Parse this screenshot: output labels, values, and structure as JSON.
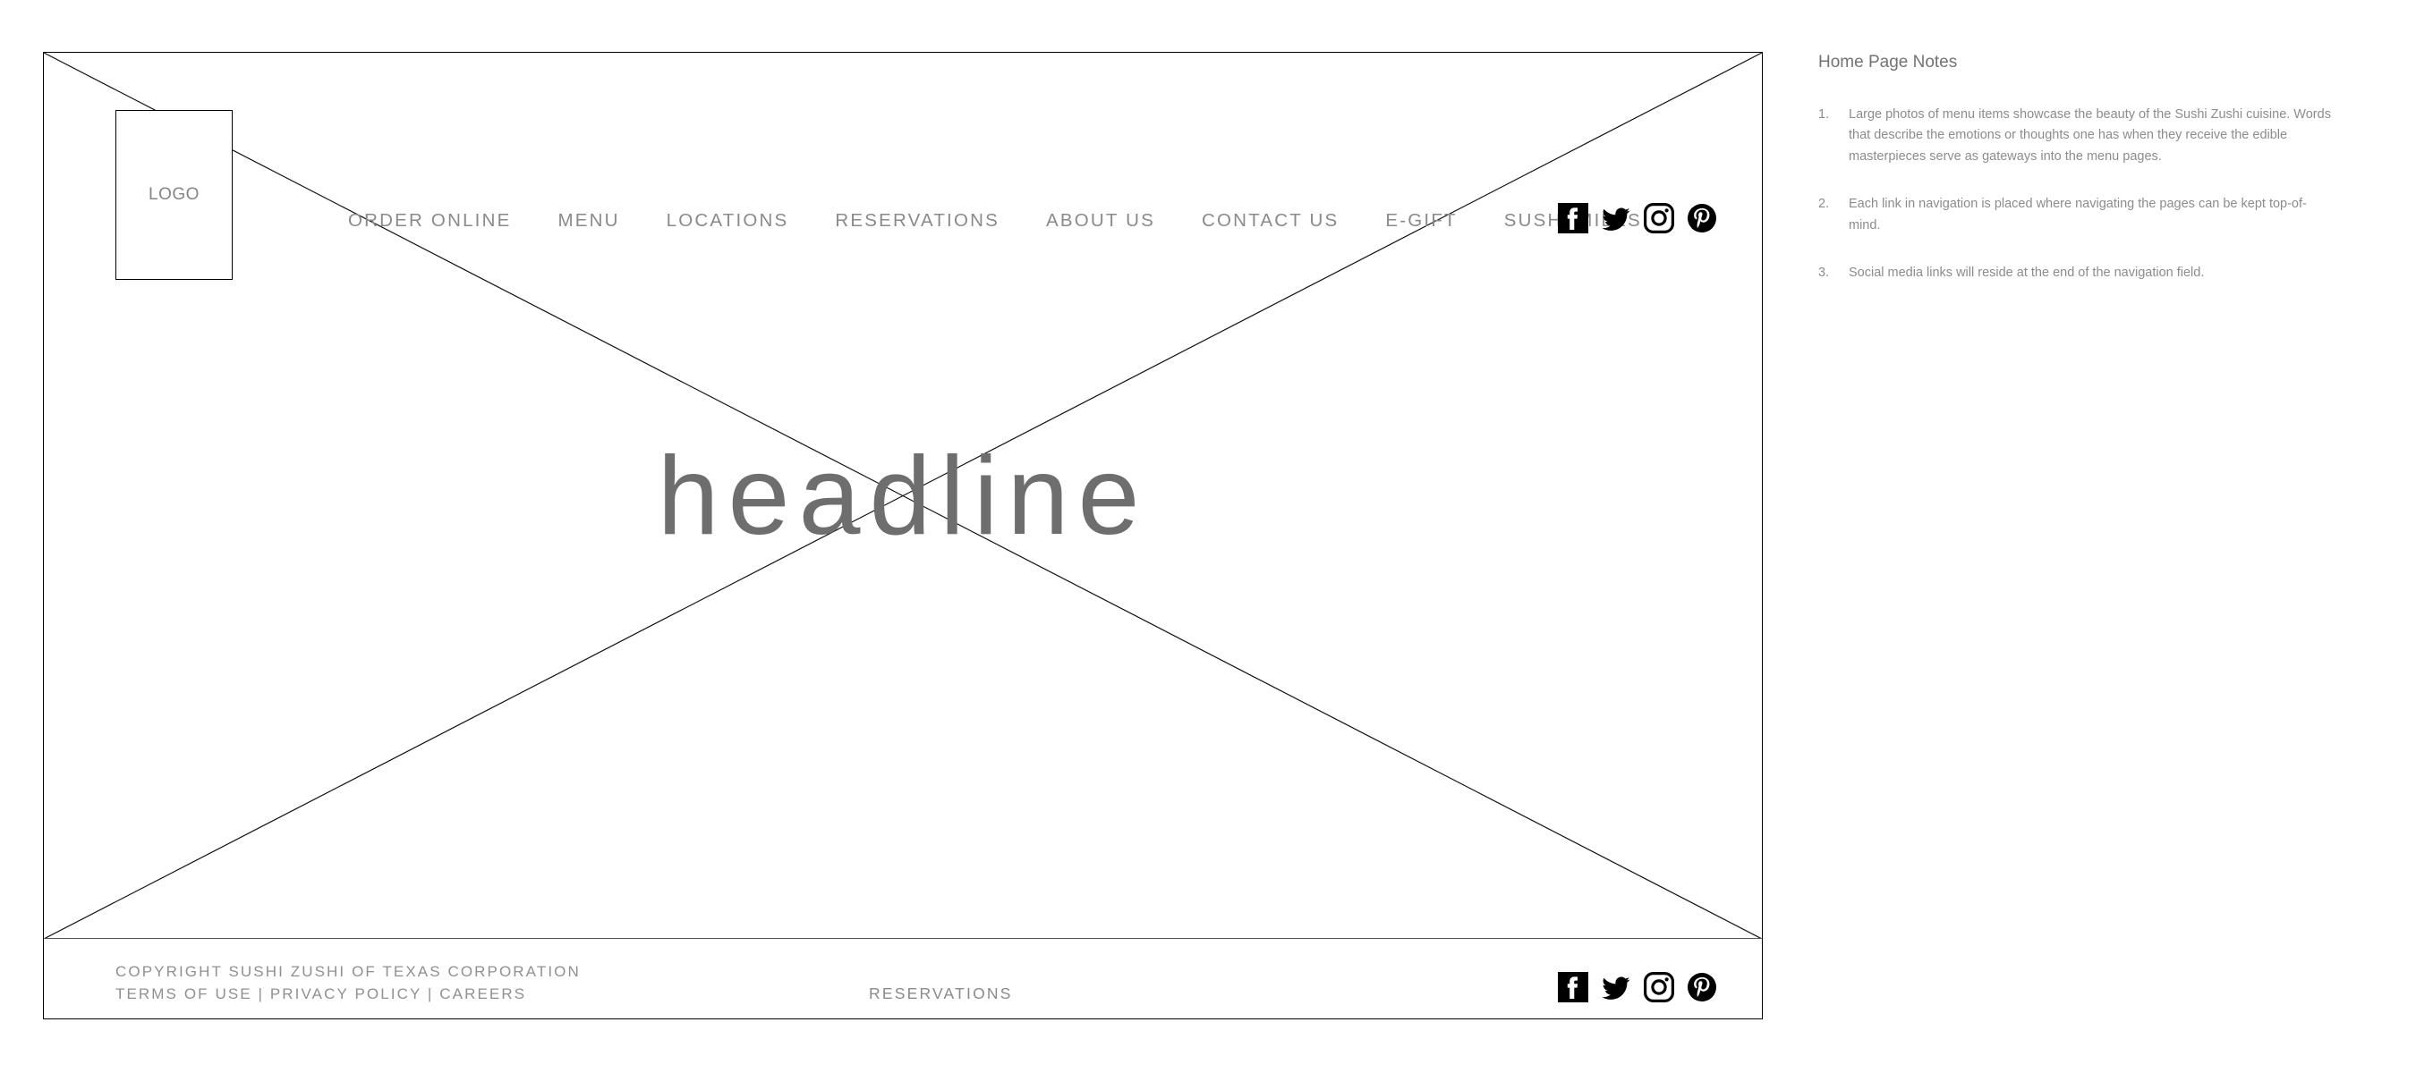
{
  "wireframe": {
    "logo": {
      "label": "LOGO"
    },
    "headline": {
      "text": "headline"
    },
    "nav": {
      "items": [
        {
          "label": "ORDER ONLINE"
        },
        {
          "label": "MENU"
        },
        {
          "label": "LOCATIONS"
        },
        {
          "label": "RESERVATIONS"
        },
        {
          "label": "ABOUT US"
        },
        {
          "label": "CONTACT US"
        },
        {
          "label": "E-GIFT"
        },
        {
          "label": "SUSHI MILES"
        }
      ],
      "social": [
        {
          "name": "facebook-icon",
          "label": "Facebook"
        },
        {
          "name": "twitter-icon",
          "label": "Twitter"
        },
        {
          "name": "instagram-icon",
          "label": "Instagram"
        },
        {
          "name": "pinterest-icon",
          "label": "Pinterest"
        }
      ]
    },
    "footer": {
      "legal_line_1": "COPYRIGHT SUSHI ZUSHI OF TEXAS CORPORATION",
      "legal_line_2": "TERMS OF USE | PRIVACY POLICY | CAREERS",
      "center_link": "RESERVATIONS",
      "social": [
        {
          "name": "facebook-icon",
          "label": "Facebook"
        },
        {
          "name": "twitter-icon",
          "label": "Twitter"
        },
        {
          "name": "instagram-icon",
          "label": "Instagram"
        },
        {
          "name": "pinterest-icon",
          "label": "Pinterest"
        }
      ]
    }
  },
  "notes": {
    "title": "Home Page Notes",
    "items": [
      {
        "number": "1.",
        "text": "Large photos of menu items showcase the beauty of the Sushi Zushi cuisine. Words that describe the emotions or thoughts one has when they receive the edible masterpieces serve as gateways into the menu pages."
      },
      {
        "number": "2.",
        "text": "Each link in navigation is placed where navigating the pages can be kept top-of-mind."
      },
      {
        "number": "3.",
        "text": "Social media links will reside at the end of the navigation field."
      }
    ]
  },
  "colors": {
    "frame_stroke": "#000000",
    "placeholder_text": "#6e6e6e",
    "nav_text": "#8a8a8a",
    "notes_text": "#8c8c8c",
    "icon_fill": "#000000",
    "background": "#ffffff"
  }
}
